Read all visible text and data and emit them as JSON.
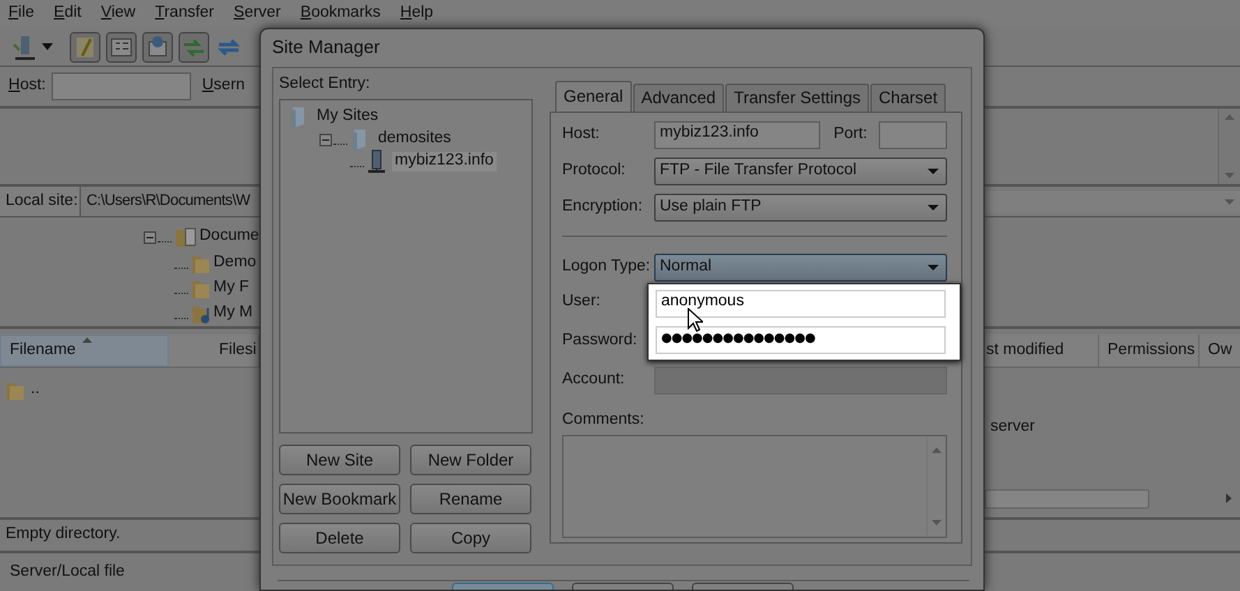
{
  "menu": [
    {
      "label": "File"
    },
    {
      "label": "Edit"
    },
    {
      "label": "View"
    },
    {
      "label": "Transfer"
    },
    {
      "label": "Server"
    },
    {
      "label": "Bookmarks"
    },
    {
      "label": "Help"
    }
  ],
  "toolbar": {
    "toggles": [
      {
        "on": true
      },
      {
        "on": true
      },
      {
        "on": true
      },
      {
        "on": true
      }
    ]
  },
  "quickconnect": {
    "host_label": "Host:",
    "user_label": "Usern"
  },
  "local_site": {
    "label": "Local site:",
    "path": "C:\\Users\\R\\Documents\\W"
  },
  "local_tree": [
    {
      "label": "Docume",
      "kind": "documents",
      "expanded": true,
      "children": [
        {
          "label": "Demo",
          "kind": "folder"
        },
        {
          "label": "My F",
          "kind": "folder"
        },
        {
          "label": "My M",
          "kind": "music"
        }
      ]
    }
  ],
  "local_files": {
    "columns": [
      {
        "label": "Filename",
        "sorted": true
      },
      {
        "label": "Filesi",
        "sorted": false
      }
    ],
    "rows": [
      {
        "name": ".."
      }
    ]
  },
  "remote_files": {
    "columns": [
      "st modified",
      "Permissions",
      "Ow"
    ],
    "message": "server"
  },
  "status": "Empty directory.",
  "queue": {
    "column": "Server/Local file"
  },
  "site_manager": {
    "title": "Site Manager",
    "select_label": "Select Entry:",
    "tree": [
      {
        "label": "My Sites",
        "kind": "folder",
        "selected": false,
        "children": [
          {
            "label": "demosites",
            "kind": "folder",
            "expanded": true,
            "selected": false,
            "children": [
              {
                "label": "mybiz123.info",
                "kind": "site",
                "selected": true
              }
            ]
          }
        ]
      }
    ],
    "buttons": [
      "New Site",
      "New Folder",
      "New Bookmark",
      "Rename",
      "Delete",
      "Copy"
    ],
    "tabs": [
      {
        "label": "General",
        "selected": true
      },
      {
        "label": "Advanced",
        "selected": false
      },
      {
        "label": "Transfer Settings",
        "selected": false
      },
      {
        "label": "Charset",
        "selected": false
      }
    ],
    "host": {
      "label": "Host:",
      "value": "mybiz123.info"
    },
    "port": {
      "label": "Port:"
    },
    "protocol": {
      "label": "Protocol:",
      "value": "FTP - File Transfer Protocol"
    },
    "encryption": {
      "label": "Encryption:",
      "value": "Use plain FTP"
    },
    "logon_type": {
      "label": "Logon Type:",
      "value": "Normal",
      "focused": true
    },
    "credentials": {
      "highlighted": true,
      "user": {
        "label": "User:",
        "value": "anonymous"
      },
      "password": {
        "label": "Password:",
        "value": "●●●●●●●●●●●●●●●"
      }
    },
    "account": {
      "label": "Account:",
      "disabled": true
    },
    "comments": {
      "label": "Comments:"
    },
    "footer_buttons": [
      {
        "default": true
      },
      {
        "default": false
      },
      {
        "default": false
      }
    ]
  }
}
